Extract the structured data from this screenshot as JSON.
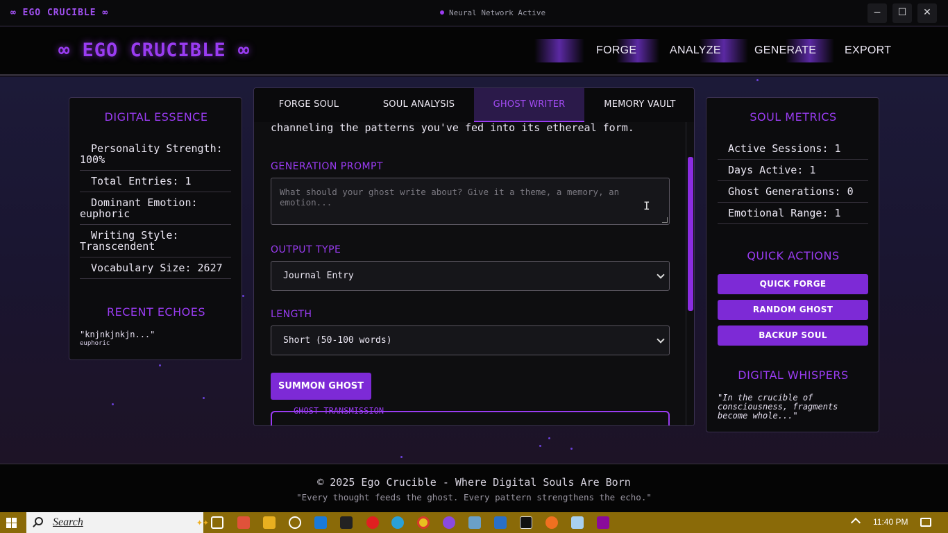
{
  "window": {
    "app_title": "∞ EGO CRUCIBLE ∞",
    "status": "Neural Network Active",
    "minimize": "−",
    "maximize": "☐",
    "close": "✕"
  },
  "header": {
    "logo": "∞ EGO CRUCIBLE ∞",
    "nav": [
      "FORGE",
      "ANALYZE",
      "GENERATE",
      "EXPORT"
    ]
  },
  "left_panel": {
    "title": "DIGITAL ESSENCE",
    "stats": [
      "Personality Strength: 100%",
      "Total Entries: 1",
      "Dominant Emotion: euphoric",
      "Writing Style: Transcendent",
      "Vocabulary Size: 2627"
    ],
    "echoes_title": "RECENT ECHOES",
    "echo_text": "\"knjnkjnkjn...\"",
    "echo_emotion": "euphoric"
  },
  "tabs": [
    "FORGE SOUL",
    "SOUL ANALYSIS",
    "GHOST WRITER",
    "MEMORY VAULT"
  ],
  "active_tab": "GHOST WRITER",
  "ghost_writer": {
    "intro": "channeling the patterns you've fed into its ethereal form.",
    "prompt_label": "GENERATION PROMPT",
    "prompt_placeholder": "What should your ghost write about? Give it a theme, a memory, an emotion...",
    "output_label": "OUTPUT TYPE",
    "output_value": "Journal Entry",
    "length_label": "LENGTH",
    "length_value": "Short (50-100 words)",
    "summon_button": "SUMMON GHOST",
    "transmission_label": "GHOST TRANSMISSION"
  },
  "right_panel": {
    "title": "SOUL METRICS",
    "stats": [
      "Active Sessions: 1",
      "Days Active: 1",
      "Ghost Generations: 0",
      "Emotional Range: 1"
    ],
    "quick_actions_title": "QUICK ACTIONS",
    "quick_actions": [
      "QUICK FORGE",
      "RANDOM GHOST",
      "BACKUP SOUL"
    ],
    "whispers_title": "DIGITAL WHISPERS",
    "whisper": "\"In the crucible of consciousness, fragments become whole...\""
  },
  "footer": {
    "copyright": "© 2025 Ego Crucible - Where Digital Souls Are Born",
    "tagline": "\"Every thought feeds the ghost. Every pattern strengthens the echo.\""
  },
  "taskbar": {
    "search": "Search",
    "time": "11:40 PM",
    "apps": [
      "task-view",
      "app-red",
      "file-explorer",
      "chatgpt",
      "vscode",
      "ai-app",
      "opera",
      "edge",
      "chrome",
      "app-purple",
      "app-generic",
      "app-blue",
      "app-dark",
      "firefox",
      "notepad",
      "app-magenta"
    ]
  },
  "colors": {
    "accent": "#9a3cf2",
    "button": "#7d2ad6",
    "taskbar": "#8a6a08"
  }
}
